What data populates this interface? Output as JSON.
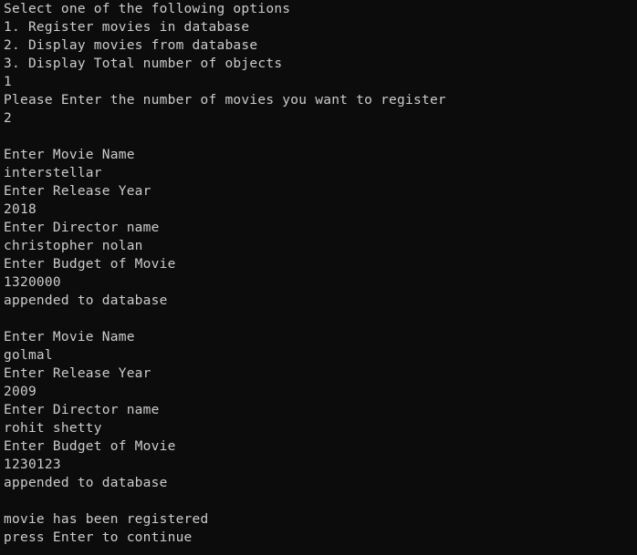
{
  "console": {
    "lines": [
      "Select one of the following options",
      "1. Register movies in database",
      "2. Display movies from database",
      "3. Display Total number of objects",
      "1",
      "Please Enter the number of movies you want to register",
      "2",
      "",
      "Enter Movie Name",
      "interstellar",
      "Enter Release Year",
      "2018",
      "Enter Director name",
      "christopher nolan",
      "Enter Budget of Movie",
      "1320000",
      "appended to database",
      "",
      "Enter Movie Name",
      "golmal",
      "Enter Release Year",
      "2009",
      "Enter Director name",
      "rohit shetty",
      "Enter Budget of Movie",
      "1230123",
      "appended to database",
      "",
      "movie has been registered",
      "press Enter to continue"
    ],
    "colors": {
      "background": "#0c0c0c",
      "text": "#cccccc"
    }
  }
}
